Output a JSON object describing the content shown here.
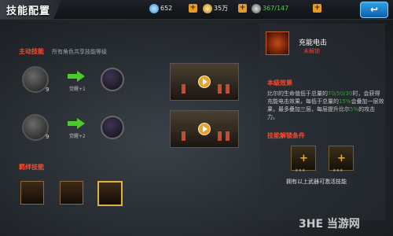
{
  "header": {
    "title": "技能配置",
    "diamonds": "652",
    "gold": "35万",
    "stamina": "367/147",
    "back_label": "↩"
  },
  "active": {
    "heading": "主动技能",
    "note": "所有角色共享技能等级",
    "rows": [
      {
        "level": "9",
        "awaken": "觉醒+1"
      },
      {
        "level": "9",
        "awaken": "觉醒+2"
      }
    ]
  },
  "bond": {
    "heading": "羁绊技能"
  },
  "detail": {
    "skill_name": "充能电击",
    "lock_text": "未解锁",
    "effect_heading": "本级效果",
    "desc_a": "比尔的生命值低于总量的",
    "desc_pct": "70/50/30",
    "desc_b": "时，会获得充能电击效果，每低于总量的",
    "desc_pct2": "15%",
    "desc_c": "会叠加一层效果，最多叠加三层，每层提升比尔",
    "desc_pct3": "5%",
    "desc_d": "的攻击力。",
    "unlock_heading": "技能解锁条件",
    "unlock_note": "拥有以上武器可激活技能"
  },
  "watermark": "3HE 当游网",
  "colors": {
    "accent": "#ff4a2a",
    "plus": "#e79c2a",
    "highlight": "#3f9a43"
  }
}
